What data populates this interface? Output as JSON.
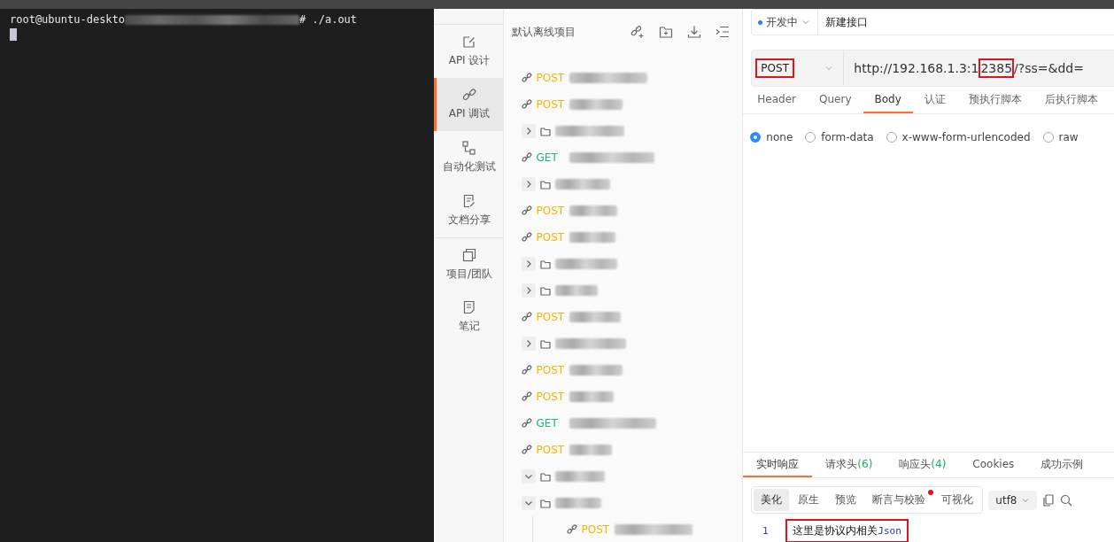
{
  "terminal": {
    "prompt_start": "root@ubuntu-deskto",
    "prompt_end": "# ./a.out"
  },
  "nav": {
    "items": [
      {
        "label": "API 设计",
        "selected": false
      },
      {
        "label": "API 调试",
        "selected": true
      },
      {
        "label": "自动化测试",
        "selected": false
      },
      {
        "label": "文档分享",
        "selected": false
      },
      {
        "label": "项目/团队",
        "selected": false
      },
      {
        "label": "笔记",
        "selected": false
      }
    ]
  },
  "tree": {
    "title": "默认离线项目",
    "items": [
      {
        "kind": "request",
        "method": "POST"
      },
      {
        "kind": "request",
        "method": "POST"
      },
      {
        "kind": "folder",
        "expanded": false
      },
      {
        "kind": "request",
        "method": "GET"
      },
      {
        "kind": "folder",
        "expanded": false
      },
      {
        "kind": "request",
        "method": "POST"
      },
      {
        "kind": "request",
        "method": "POST"
      },
      {
        "kind": "folder",
        "expanded": false
      },
      {
        "kind": "folder",
        "expanded": false
      },
      {
        "kind": "request",
        "method": "POST"
      },
      {
        "kind": "folder",
        "expanded": false
      },
      {
        "kind": "request",
        "method": "POST"
      },
      {
        "kind": "request",
        "method": "POST"
      },
      {
        "kind": "request",
        "method": "GET"
      },
      {
        "kind": "request",
        "method": "POST"
      },
      {
        "kind": "folder",
        "expanded": true
      },
      {
        "kind": "folder",
        "expanded": true,
        "children": [
          {
            "kind": "request",
            "method": "POST"
          }
        ]
      }
    ]
  },
  "request": {
    "status": "开发中",
    "name": "新建接口",
    "method": {
      "label": "POST",
      "highlighted": true
    },
    "url_parts": [
      {
        "text": "http://192.168.1.3:1",
        "highlighted": false
      },
      {
        "text": "2385",
        "highlighted": true
      },
      {
        "text": "/?ss=&dd=",
        "highlighted": false
      }
    ],
    "tabs": [
      {
        "label": "Header",
        "selected": false
      },
      {
        "label": "Query",
        "selected": false
      },
      {
        "label": "Body",
        "selected": true
      },
      {
        "label": "认证",
        "selected": false
      },
      {
        "label": "预执行脚本",
        "selected": false
      },
      {
        "label": "后执行脚本",
        "selected": false
      }
    ],
    "body_types": [
      {
        "label": "none",
        "selected": true
      },
      {
        "label": "form-data",
        "selected": false
      },
      {
        "label": "x-www-form-urlencoded",
        "selected": false
      },
      {
        "label": "raw",
        "selected": false
      }
    ]
  },
  "response": {
    "tabs": [
      {
        "label": "实时响应",
        "selected": true
      },
      {
        "label": "请求头",
        "count": "(6)",
        "selected": false
      },
      {
        "label": "响应头",
        "count": "(4)",
        "selected": false
      },
      {
        "label": "Cookies",
        "selected": false
      },
      {
        "label": "成功示例",
        "selected": false
      }
    ],
    "views": [
      {
        "label": "美化",
        "selected": true,
        "dot": false
      },
      {
        "label": "原生",
        "selected": false,
        "dot": false
      },
      {
        "label": "预览",
        "selected": false,
        "dot": false
      },
      {
        "label": "断言与校验",
        "selected": false,
        "dot": true
      },
      {
        "label": "可视化",
        "selected": false,
        "dot": false
      }
    ],
    "encoding": "utf8",
    "lines": [
      {
        "number": "1",
        "text": "这里是协议内相关",
        "token": "Json",
        "highlighted": true
      }
    ]
  }
}
